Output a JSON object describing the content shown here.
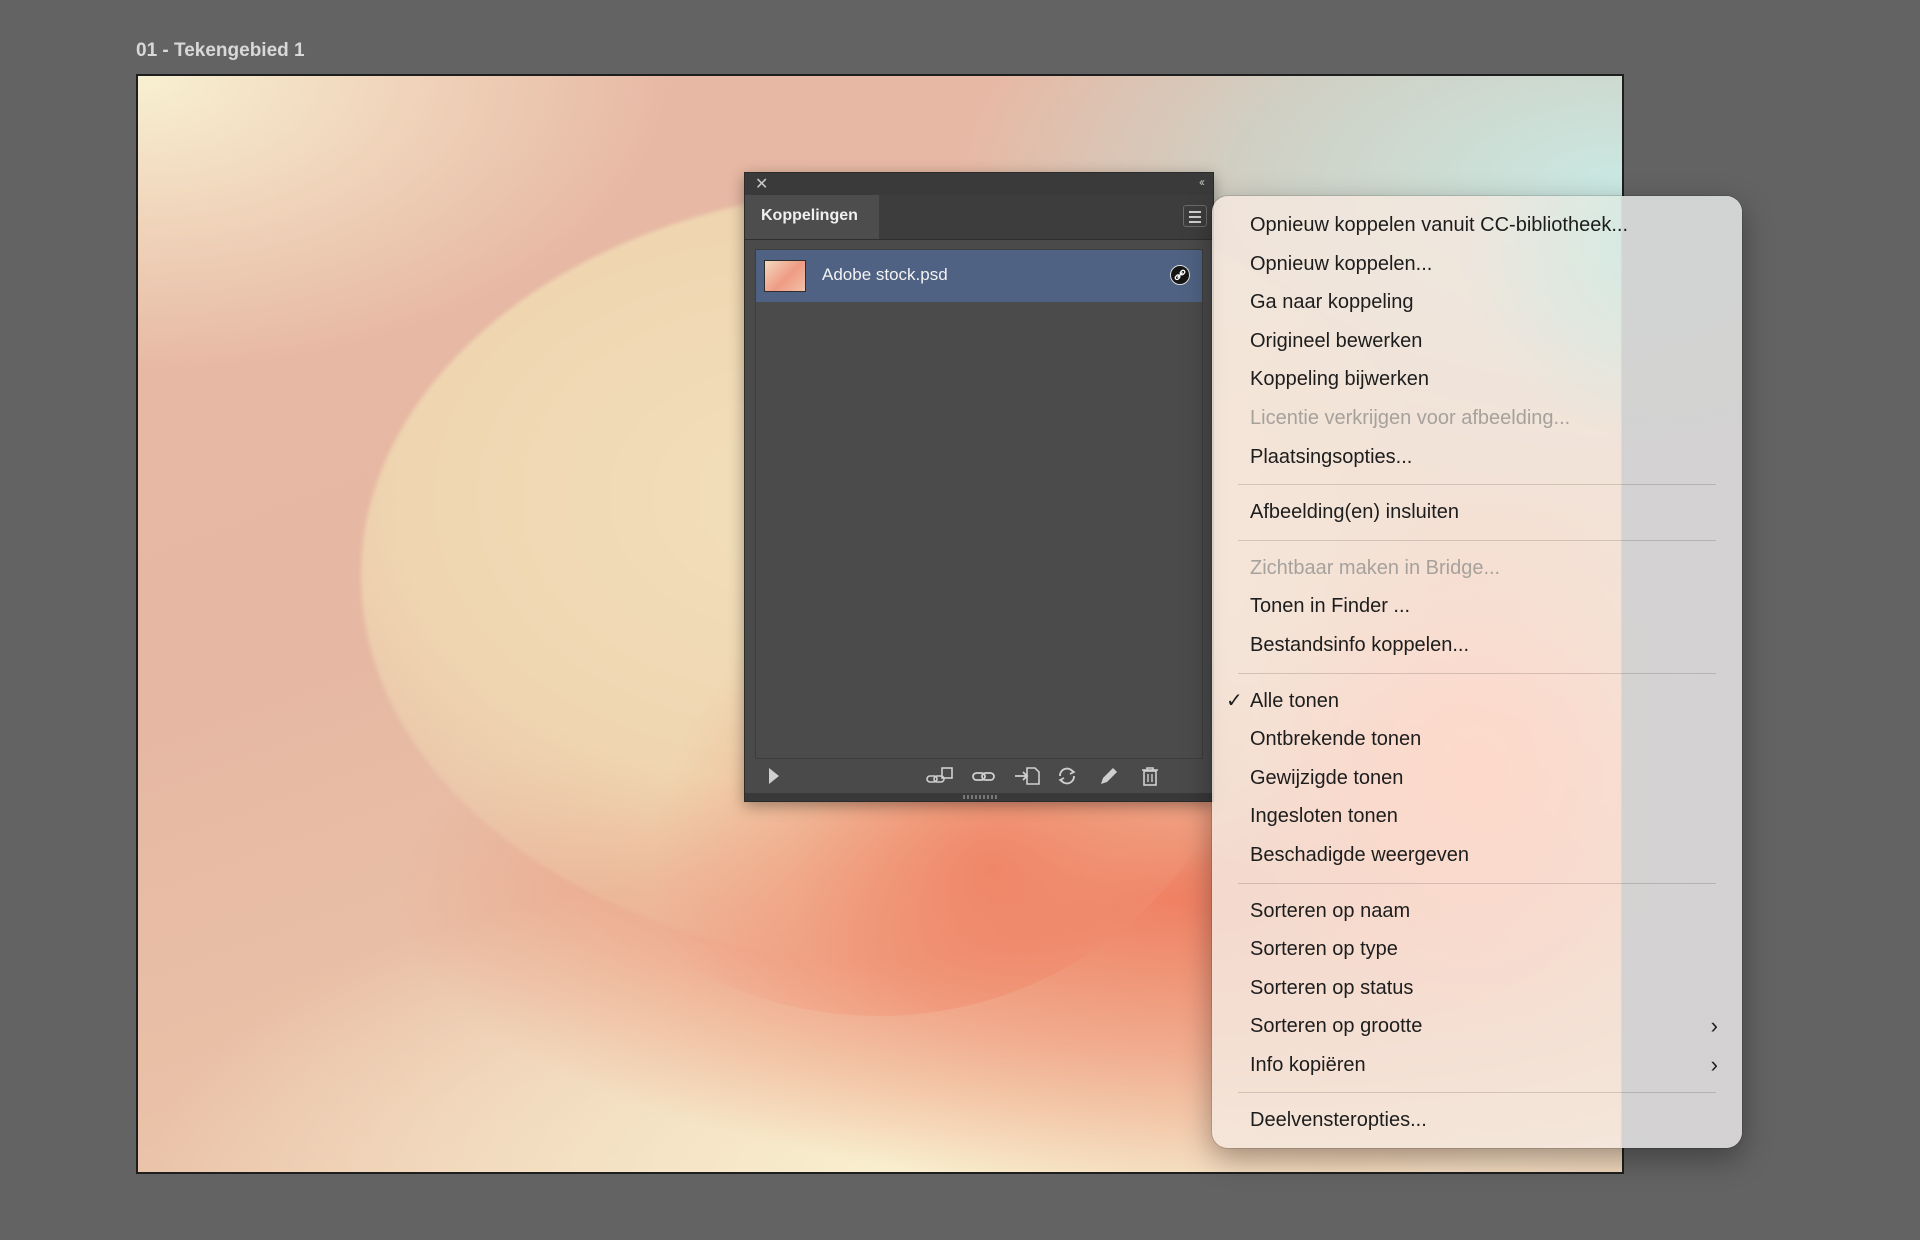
{
  "artboard": {
    "label": "01 - Tekengebied 1"
  },
  "links_panel": {
    "close_icon": "close-icon",
    "collapse_icon": "double-chevron-left-icon",
    "tab_label": "Koppelingen",
    "menu_icon": "hamburger-menu-icon",
    "items": [
      {
        "name": "Adobe stock.psd",
        "status_icon": "link-icon"
      }
    ],
    "footer_icons": [
      "relink-from-cc-library-icon",
      "relink-icon",
      "go-to-link-icon",
      "update-link-icon",
      "edit-original-icon",
      "delete-icon"
    ],
    "selection_color": "#4f6283"
  },
  "context_menu": {
    "items": [
      {
        "label": "Opnieuw koppelen vanuit CC-bibliotheek...",
        "enabled": true
      },
      {
        "label": "Opnieuw koppelen...",
        "enabled": true
      },
      {
        "label": "Ga naar koppeling",
        "enabled": true
      },
      {
        "label": "Origineel bewerken",
        "enabled": true
      },
      {
        "label": "Koppeling bijwerken",
        "enabled": true
      },
      {
        "label": "Licentie verkrijgen voor afbeelding...",
        "enabled": false
      },
      {
        "label": "Plaatsingsopties...",
        "enabled": true
      },
      {
        "separator": true
      },
      {
        "label": "Afbeelding(en) insluiten",
        "enabled": true
      },
      {
        "separator": true
      },
      {
        "label": "Zichtbaar maken in Bridge...",
        "enabled": false
      },
      {
        "label": "Tonen in Finder ...",
        "enabled": true
      },
      {
        "label": "Bestandsinfo koppelen...",
        "enabled": true
      },
      {
        "separator": true
      },
      {
        "label": "Alle tonen",
        "enabled": true,
        "checked": true
      },
      {
        "label": "Ontbrekende tonen",
        "enabled": true
      },
      {
        "label": "Gewijzigde tonen",
        "enabled": true
      },
      {
        "label": "Ingesloten tonen",
        "enabled": true
      },
      {
        "label": "Beschadigde weergeven",
        "enabled": true
      },
      {
        "separator": true
      },
      {
        "label": "Sorteren op naam",
        "enabled": true
      },
      {
        "label": "Sorteren op type",
        "enabled": true
      },
      {
        "label": "Sorteren op status",
        "enabled": true
      },
      {
        "label": "Sorteren op grootte",
        "enabled": true,
        "submenu": true
      },
      {
        "label": "Info kopiëren",
        "enabled": true,
        "submenu": true
      },
      {
        "separator": true
      },
      {
        "label": "Deelvensteropties...",
        "enabled": true
      }
    ]
  }
}
